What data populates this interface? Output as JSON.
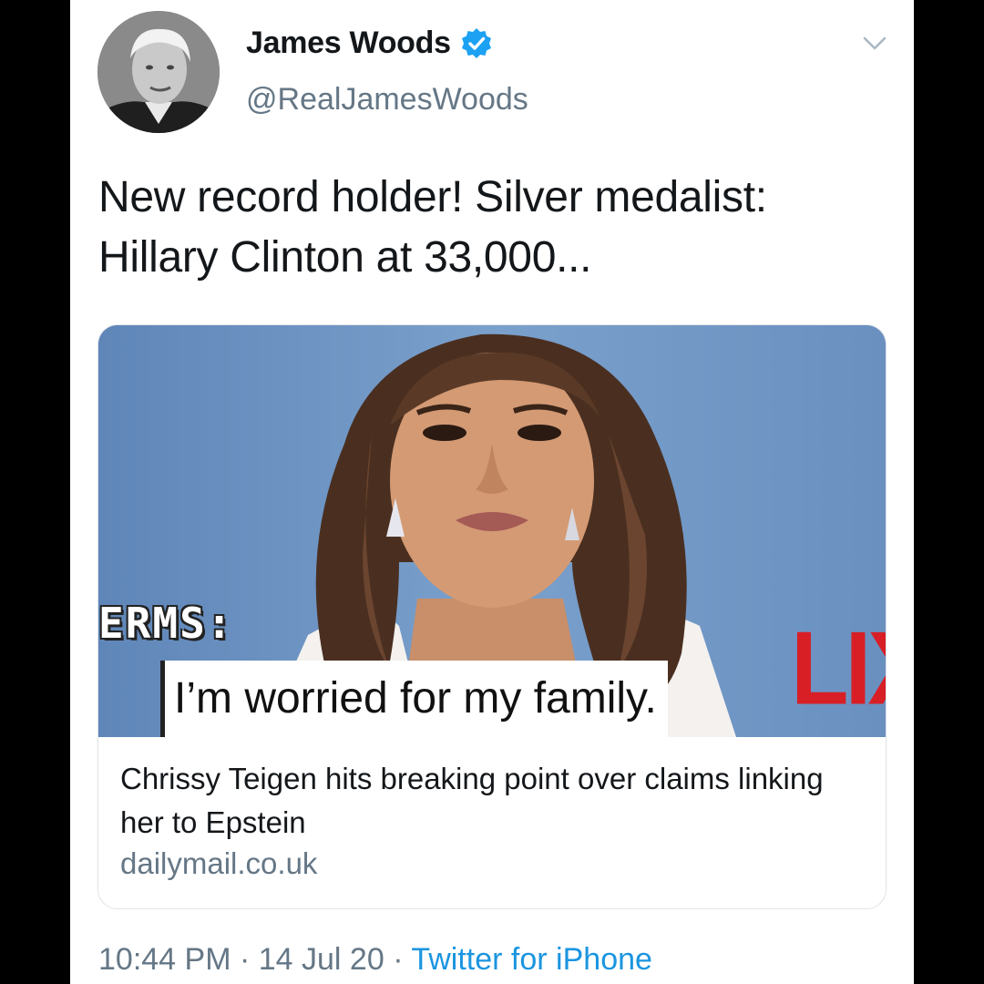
{
  "author": {
    "display_name": "James Woods",
    "handle": "@RealJamesWoods",
    "verified": true
  },
  "tweet": {
    "text_line1": "New record holder! Silver medalist:",
    "text_line2": "Hillary Clinton at 33,000..."
  },
  "card": {
    "image_caption": "I’m worried for my family.",
    "overlay_left": "ERMS:",
    "overlay_right": "LIX",
    "title": "Chrissy Teigen hits breaking point over claims linking her to Epstein",
    "domain": "dailymail.co.uk"
  },
  "meta": {
    "time": "10:44 PM",
    "separator1": " · ",
    "date": "14 Jul 20",
    "separator2": " · ",
    "source": "Twitter for iPhone"
  },
  "colors": {
    "text_primary": "#14171a",
    "text_secondary": "#657786",
    "link_blue": "#1b95e0",
    "verified_blue": "#1da1f2",
    "card_border": "#dfe4e8",
    "photo_backdrop": "#6f95c3"
  },
  "icons": {
    "verified": "verified-badge-icon",
    "menu": "chevron-down-icon"
  }
}
